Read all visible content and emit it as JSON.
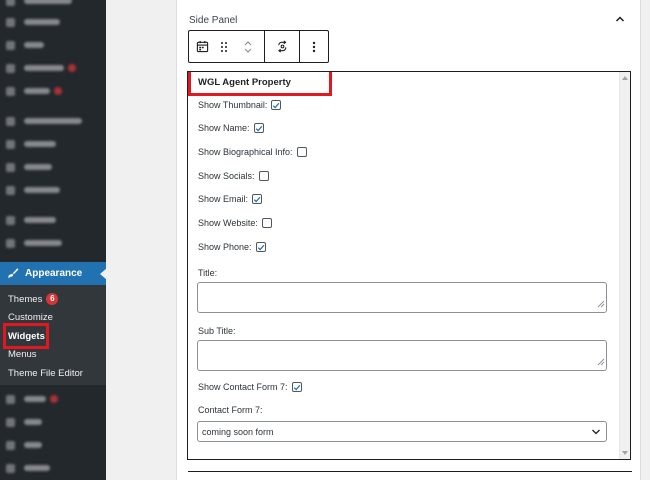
{
  "sidebar": {
    "blurred_items": [
      {
        "text_width": 48,
        "badge": false
      },
      {
        "text_width": 36,
        "badge": false
      },
      {
        "text_width": 20,
        "badge": false
      },
      {
        "text_width": 40,
        "badge": true
      },
      {
        "text_width": 26,
        "badge": true
      },
      {
        "text_width": 58,
        "badge": false
      },
      {
        "text_width": 32,
        "badge": false
      },
      {
        "text_width": 28,
        "badge": false
      },
      {
        "text_width": 36,
        "badge": false
      },
      {
        "text_width": 32,
        "badge": false
      },
      {
        "text_width": 38,
        "badge": false
      }
    ],
    "appearance_label": "Appearance",
    "submenu": {
      "themes_label": "Themes",
      "themes_badge": "6",
      "customize_label": "Customize",
      "widgets_label": "Widgets",
      "menus_label": "Menus",
      "theme_file_editor_label": "Theme File Editor"
    },
    "blurred_items_below": [
      {
        "text_width": 22,
        "badge": true
      },
      {
        "text_width": 18,
        "badge": false
      },
      {
        "text_width": 18,
        "badge": false
      },
      {
        "text_width": 26,
        "badge": false
      }
    ]
  },
  "panel": {
    "title": "Side Panel",
    "widget": {
      "title": "WGL Agent Property",
      "options": [
        {
          "label": "Show Thumbnail:",
          "checked": true
        },
        {
          "label": "Show Name:",
          "checked": true
        },
        {
          "label": "Show Biographical Info:",
          "checked": false
        },
        {
          "label": "Show Socials:",
          "checked": false
        },
        {
          "label": "Show Email:",
          "checked": true
        },
        {
          "label": "Show Website:",
          "checked": false
        },
        {
          "label": "Show Phone:",
          "checked": true
        }
      ],
      "title_field_label": "Title:",
      "title_field_value": "",
      "subtitle_field_label": "Sub Title:",
      "subtitle_field_value": "",
      "contact_form_toggle": {
        "label": "Show Contact Form 7:",
        "checked": true
      },
      "contact_form_select_label": "Contact Form 7:",
      "contact_form_selected": "coming soon form"
    }
  },
  "colors": {
    "sidebar_bg": "#23282d",
    "submenu_bg": "#32373c",
    "active_blue": "#2271b1",
    "highlight_red": "#e0181f",
    "checkbox_check": "#2271b1"
  }
}
